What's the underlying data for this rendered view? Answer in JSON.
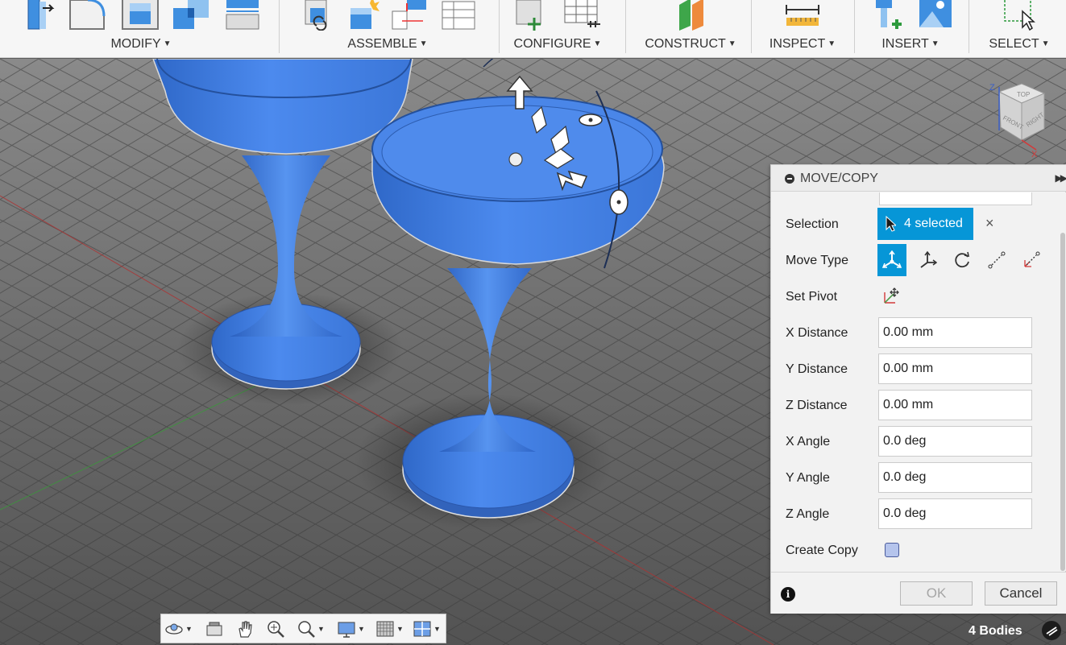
{
  "ribbon": {
    "groups": [
      {
        "label": "MODIFY",
        "icons": [
          "press-pull-icon",
          "fillet-icon",
          "shell-icon",
          "combine-icon",
          "offset-face-icon"
        ]
      },
      {
        "label": "ASSEMBLE",
        "icons": [
          "new-component-icon",
          "joint-icon",
          "as-built-joint-icon",
          "joint-origin-icon",
          "table-icon"
        ]
      },
      {
        "label": "CONFIGURE",
        "icons": [
          "configure-part-icon",
          "configure-table-icon"
        ]
      },
      {
        "label": "CONSTRUCT",
        "icons": [
          "offset-plane-icon"
        ]
      },
      {
        "label": "INSPECT",
        "icons": [
          "measure-icon"
        ]
      },
      {
        "label": "INSERT",
        "icons": [
          "insert-mcmaster-icon",
          "canvas-image-icon"
        ]
      },
      {
        "label": "SELECT",
        "icons": [
          "window-select-icon"
        ]
      }
    ]
  },
  "viewcube": {
    "faces": [
      "TOP",
      "FRONT",
      "RIGHT"
    ],
    "axes": [
      "Z",
      "X"
    ]
  },
  "dialog": {
    "title": "MOVE/COPY",
    "expand_glyph": "▶▶",
    "selection": {
      "label": "Selection",
      "value": "4 selected",
      "clear": "×"
    },
    "move_type": {
      "label": "Move Type",
      "options": [
        "free-move-icon",
        "translate-icon",
        "rotate-icon",
        "point-to-point-icon",
        "point-to-position-icon"
      ],
      "active": "free-move-icon"
    },
    "set_pivot": {
      "label": "Set Pivot"
    },
    "fields": [
      {
        "label": "X Distance",
        "value": "0.00 mm"
      },
      {
        "label": "Y Distance",
        "value": "0.00 mm"
      },
      {
        "label": "Z Distance",
        "value": "0.00 mm"
      },
      {
        "label": "X Angle",
        "value": "0.0 deg"
      },
      {
        "label": "Y Angle",
        "value": "0.0 deg"
      },
      {
        "label": "Z Angle",
        "value": "0.0 deg"
      }
    ],
    "create_copy": {
      "label": "Create Copy",
      "checked": false
    },
    "ok": "OK",
    "cancel": "Cancel",
    "info": "i"
  },
  "navbar": {
    "tools": [
      "orbit-icon",
      "look-at-icon",
      "pan-icon",
      "zoom-icon",
      "fit-icon",
      "display-settings-icon",
      "grid-settings-icon",
      "viewports-icon"
    ]
  },
  "status": {
    "bodies": "4 Bodies"
  },
  "colors": {
    "body": "#3f7fe0",
    "accent": "#0696d7",
    "grid": "#5d5d5d"
  }
}
